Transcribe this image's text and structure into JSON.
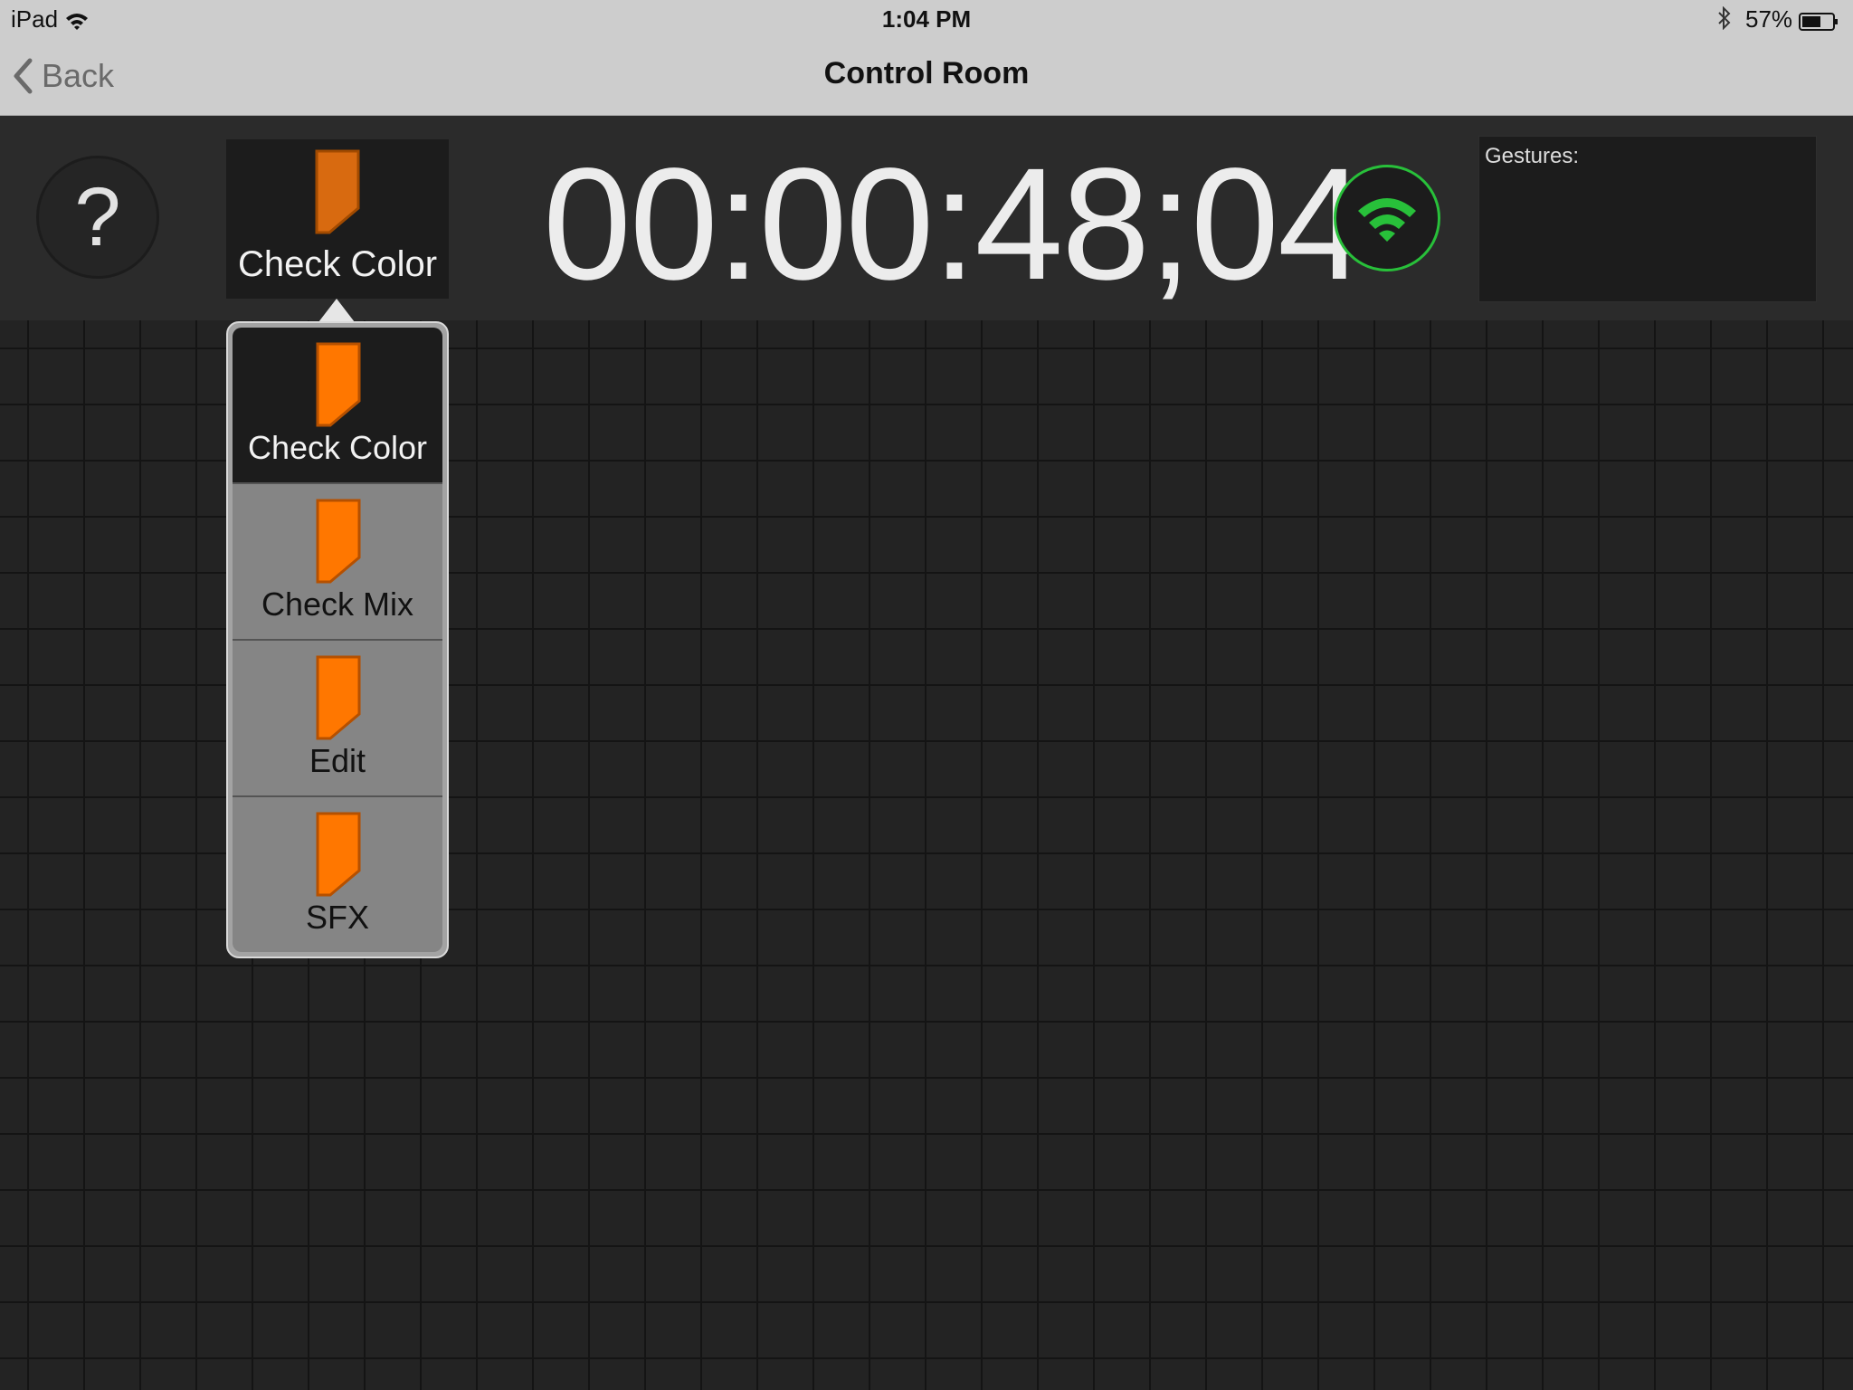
{
  "status_bar": {
    "device": "iPad",
    "time": "1:04 PM",
    "battery_percent": "57%",
    "icons": [
      "wifi-icon",
      "bluetooth-icon",
      "battery-icon"
    ]
  },
  "nav": {
    "back_label": "Back",
    "title": "Control Room"
  },
  "toolbar": {
    "help_label": "?",
    "current_preset": "Check Color",
    "timecode": "00:00:48;04",
    "connection_status_icon": "wifi-icon",
    "gestures_label": "Gestures:"
  },
  "dropdown": {
    "items": [
      {
        "label": "Check Color",
        "selected": true
      },
      {
        "label": "Check Mix",
        "selected": false
      },
      {
        "label": "Edit",
        "selected": false
      },
      {
        "label": "SFX",
        "selected": false
      }
    ]
  },
  "colors": {
    "flag_orange": "#ff7700",
    "connection_green": "#28c03a",
    "background": "#232323"
  }
}
